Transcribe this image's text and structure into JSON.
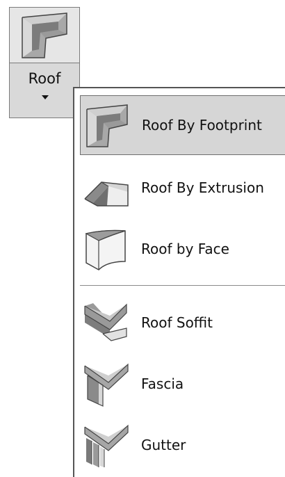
{
  "ribbon": {
    "button_label": "Roof",
    "icon": "roof-footprint-icon"
  },
  "menu": {
    "items": [
      {
        "label": "Roof By Footprint",
        "icon": "roof-footprint-icon",
        "selected": true
      },
      {
        "label": "Roof By Extrusion",
        "icon": "roof-extrusion-icon",
        "selected": false
      },
      {
        "label": "Roof by Face",
        "icon": "roof-face-icon",
        "selected": false
      },
      {
        "label": "Roof Soffit",
        "icon": "roof-soffit-icon",
        "selected": false
      },
      {
        "label": "Fascia",
        "icon": "fascia-icon",
        "selected": false
      },
      {
        "label": "Gutter",
        "icon": "gutter-icon",
        "selected": false
      }
    ]
  },
  "colors": {
    "selected_background": "#d6d6d6",
    "border": "#6e6e6e"
  }
}
